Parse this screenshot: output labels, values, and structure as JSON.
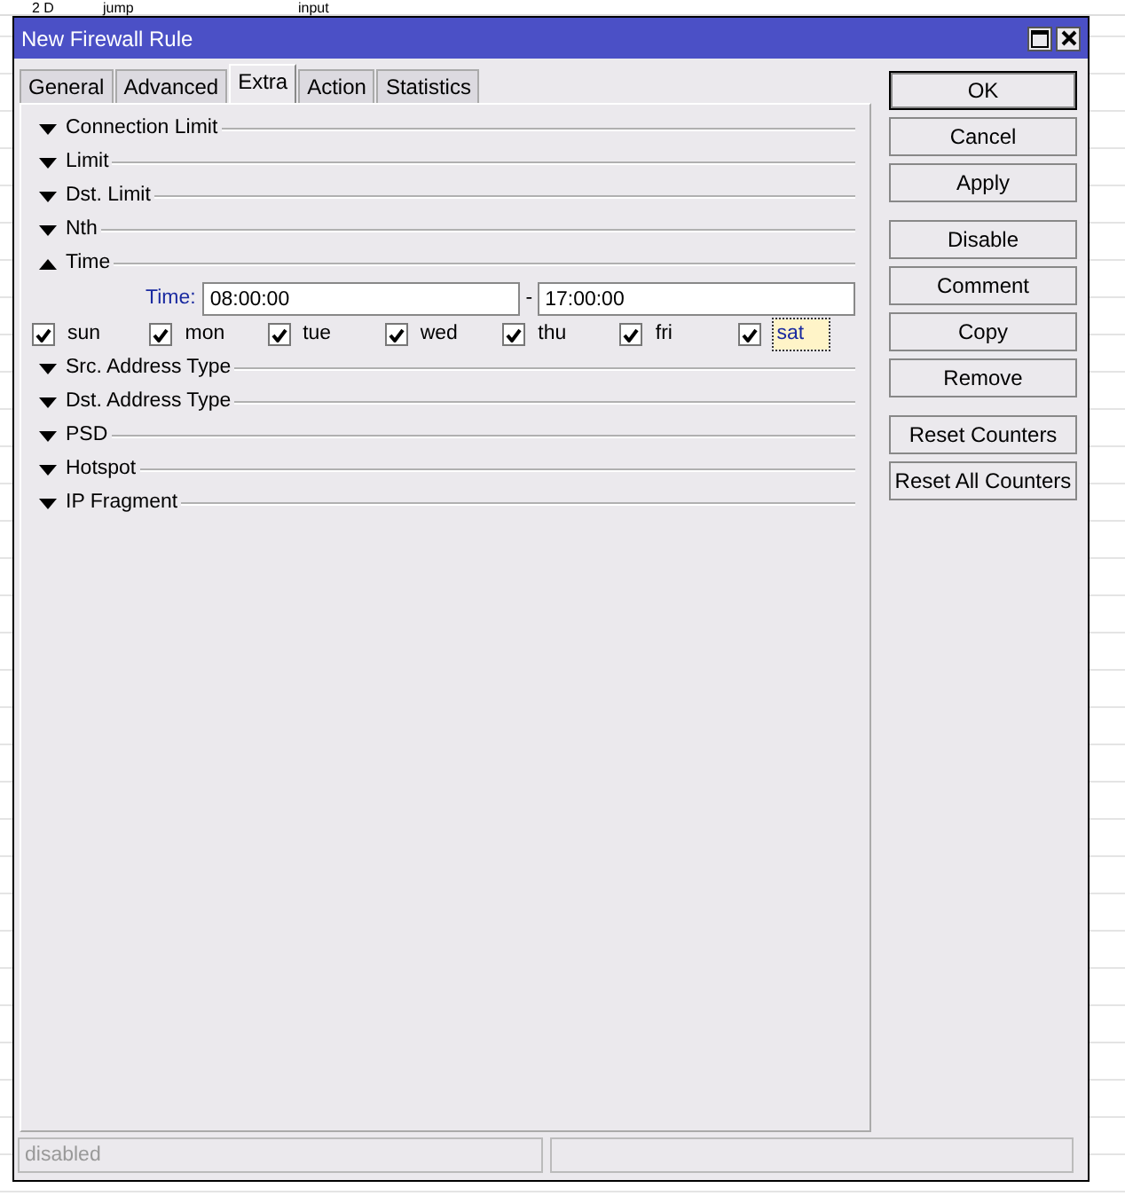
{
  "background_table": {
    "row": [
      "2 D",
      "jump",
      "input"
    ]
  },
  "window": {
    "title": "New Firewall Rule"
  },
  "tabs": [
    {
      "label": "General",
      "selected": false
    },
    {
      "label": "Advanced",
      "selected": false
    },
    {
      "label": "Extra",
      "selected": true
    },
    {
      "label": "Action",
      "selected": false
    },
    {
      "label": "Statistics",
      "selected": false
    }
  ],
  "sections": [
    {
      "title": "Connection Limit",
      "expanded": false
    },
    {
      "title": "Limit",
      "expanded": false
    },
    {
      "title": "Dst. Limit",
      "expanded": false
    },
    {
      "title": "Nth",
      "expanded": false
    },
    {
      "title": "Time",
      "expanded": true,
      "time": {
        "label": "Time:",
        "from": "08:00:00",
        "separator": "-",
        "to": "17:00:00"
      },
      "days": [
        {
          "label": "sun",
          "checked": true,
          "focused": false
        },
        {
          "label": "mon",
          "checked": true,
          "focused": false
        },
        {
          "label": "tue",
          "checked": true,
          "focused": false
        },
        {
          "label": "wed",
          "checked": true,
          "focused": false
        },
        {
          "label": "thu",
          "checked": true,
          "focused": false
        },
        {
          "label": "fri",
          "checked": true,
          "focused": false
        },
        {
          "label": "sat",
          "checked": true,
          "focused": true
        }
      ]
    },
    {
      "title": "Src. Address Type",
      "expanded": false
    },
    {
      "title": "Dst. Address Type",
      "expanded": false
    },
    {
      "title": "PSD",
      "expanded": false
    },
    {
      "title": "Hotspot",
      "expanded": false
    },
    {
      "title": "IP Fragment",
      "expanded": false
    }
  ],
  "button_groups": [
    [
      {
        "label": "OK",
        "default": true
      },
      {
        "label": "Cancel",
        "default": false
      },
      {
        "label": "Apply",
        "default": false
      }
    ],
    [
      {
        "label": "Disable",
        "default": false
      },
      {
        "label": "Comment",
        "default": false
      },
      {
        "label": "Copy",
        "default": false
      },
      {
        "label": "Remove",
        "default": false
      }
    ],
    [
      {
        "label": "Reset Counters",
        "default": false
      },
      {
        "label": "Reset All Counters",
        "default": false
      }
    ]
  ],
  "status_bar": {
    "text": "disabled"
  }
}
